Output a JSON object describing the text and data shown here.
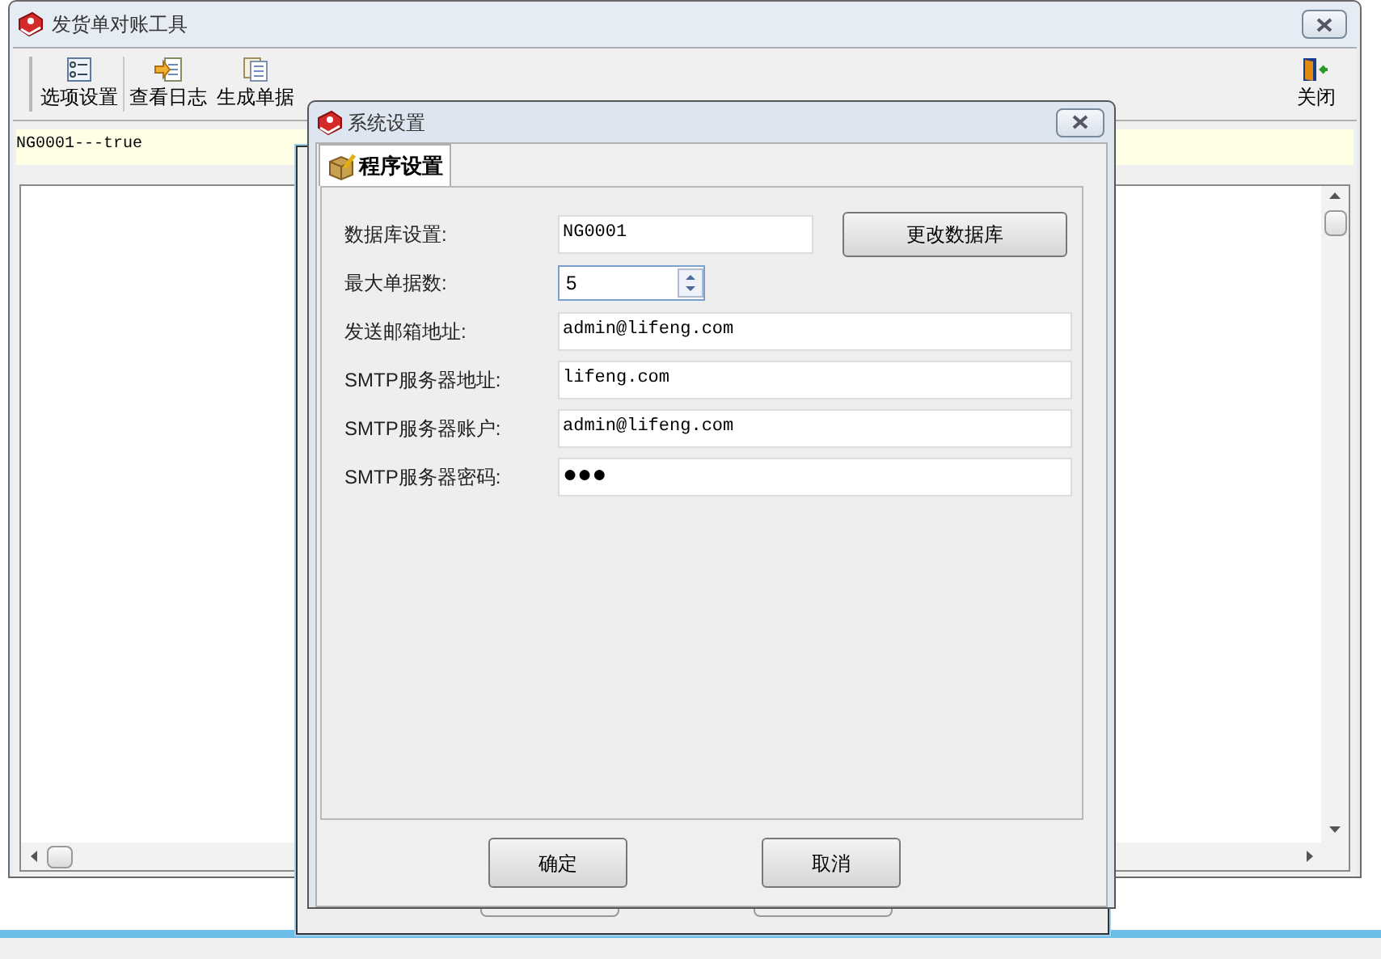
{
  "main_window": {
    "title": "发货单对账工具",
    "toolbar": [
      {
        "kind": "options",
        "label": "选项设置"
      },
      {
        "kind": "log",
        "label": "查看日志"
      },
      {
        "kind": "generate",
        "label": "生成单据"
      },
      {
        "kind": "close",
        "label": "关闭"
      }
    ],
    "status_text": "NG0001---true"
  },
  "dialog": {
    "title": "系统设置",
    "tabs": [
      {
        "label": "程序设置",
        "selected": true
      }
    ],
    "fields": [
      {
        "kind": "text",
        "label": "数据库设置:",
        "value": "NG0001"
      },
      {
        "kind": "spin",
        "label": "最大单据数:",
        "value": "5"
      },
      {
        "kind": "text",
        "label": "发送邮箱地址:",
        "value": "admin@lifeng.com"
      },
      {
        "kind": "text",
        "label": "SMTP服务器地址:",
        "value": "lifeng.com"
      },
      {
        "kind": "text",
        "label": "SMTP服务器账户:",
        "value": "admin@lifeng.com"
      },
      {
        "kind": "password",
        "label": "SMTP服务器密码:",
        "value": "●●●"
      }
    ],
    "change_db_button": "更改数据库",
    "buttons": [
      "确定",
      "取消"
    ]
  }
}
